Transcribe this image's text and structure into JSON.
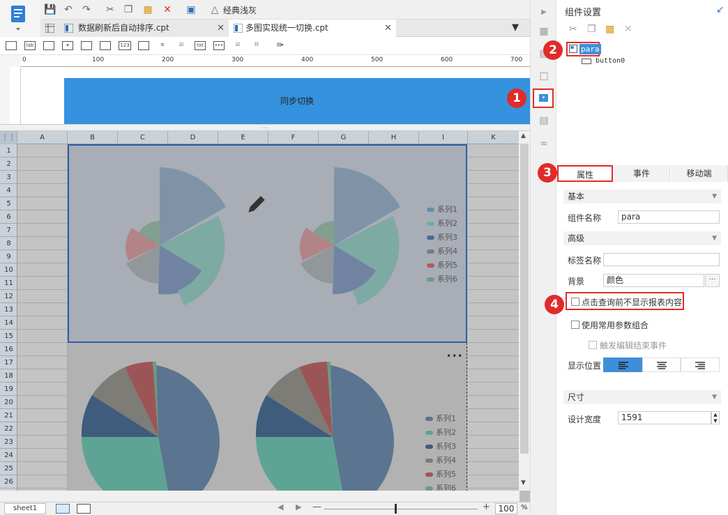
{
  "toolbar": {
    "theme_label": "经典浅灰"
  },
  "tabs": [
    {
      "label": "数据刷新后自动排序.cpt"
    },
    {
      "label": "多图实现统一切换.cpt"
    }
  ],
  "ruler": {
    "ticks": [
      "0",
      "100",
      "200",
      "300",
      "400",
      "500",
      "600",
      "700"
    ]
  },
  "para_band": {
    "title": "同步切换"
  },
  "grid": {
    "columns": [
      "A",
      "B",
      "C",
      "D",
      "E",
      "F",
      "G",
      "H",
      "I",
      "K"
    ],
    "rows": [
      "1",
      "2",
      "3",
      "4",
      "5",
      "6",
      "7",
      "8",
      "9",
      "10",
      "11",
      "12",
      "13",
      "14",
      "15",
      "16",
      "17",
      "18",
      "19",
      "20",
      "21",
      "22",
      "23",
      "24",
      "25",
      "26"
    ]
  },
  "charts": {
    "legend_top": [
      "系列1",
      "系列2",
      "系列3",
      "系列4",
      "系列5",
      "系列6"
    ],
    "legend_bottom": [
      "系列1",
      "系列2",
      "系列3",
      "系列4",
      "系列5",
      "系列6"
    ],
    "more_label": "•••",
    "colors": [
      "#6e8ba4",
      "#64b3a6",
      "#4a6a93",
      "#7a7a7a",
      "#b55a5e",
      "#6f9a82"
    ]
  },
  "bottom_bar": {
    "sheet_name": "sheet1",
    "zoom": "100",
    "zoom_unit": "%"
  },
  "panel": {
    "title": "组件设置",
    "tree": {
      "root": "para",
      "child": "button0"
    },
    "tabs": [
      "属性",
      "事件",
      "移动端"
    ],
    "basic_section": "基本",
    "widget_name_label": "组件名称",
    "widget_name_value": "para",
    "advanced_section": "高级",
    "tag_name_label": "标签名称",
    "tag_name_value": "",
    "background_label": "背景",
    "background_value": "颜色",
    "background_more": "···",
    "checkbox_hide_label": "点击查询前不显示报表内容",
    "checkbox_common_label": "使用常用参数组合",
    "checkbox_trigger_label": "触发编辑结束事件",
    "position_label": "显示位置",
    "size_section": "尺寸",
    "design_width_label": "设计宽度",
    "design_width_value": "1591"
  },
  "badges": [
    "1",
    "2",
    "3",
    "4"
  ]
}
